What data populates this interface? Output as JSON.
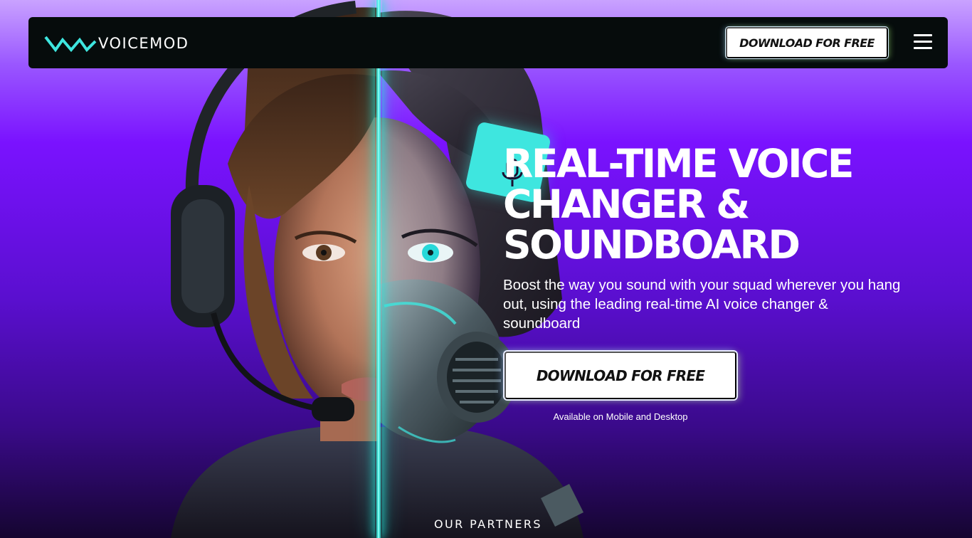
{
  "brand": {
    "name": "VOICEMOD",
    "accent_color": "#3ee6df",
    "logo_icon": "voicemod-logo-icon"
  },
  "navbar": {
    "download_label": "DOWNLOAD FOR FREE",
    "menu_icon": "hamburger-menu-icon"
  },
  "hero": {
    "headline": "REAL-TIME VOICE\nCHANGER &\nSOUNDBOARD",
    "subtext": "Boost the way you sound with your squad wherever you hang out, using the leading real-time AI voice changer & soundboard",
    "cta_label": "DOWNLOAD FOR FREE",
    "availability": "Available on Mobile and Desktop",
    "badge_icon": "microphone-icon"
  },
  "partners": {
    "heading": "OUR PARTNERS"
  }
}
